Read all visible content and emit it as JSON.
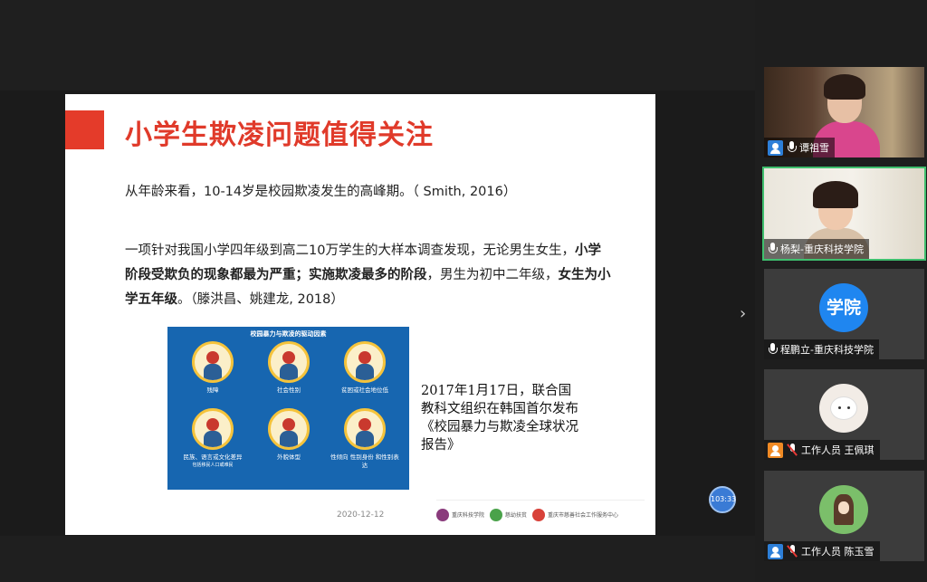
{
  "slide": {
    "title": "小学生欺凌问题值得关注",
    "paragraph1": "从年龄来看，10-14岁是校园欺凌发生的高峰期。（ Smith, 2016）",
    "paragraph2": {
      "t1": "一项针对我国小学四年级到高二10万学生的大样本调查发现，无论男生女生，",
      "b1": "小学阶段受欺负的现象都最为严重；实施欺凌最多的阶段",
      "t2": "，男生为初中二年级，",
      "b2": "女生为小学五年级",
      "t3": "。（滕洪昌、姚建龙, 2018）"
    },
    "infographic": {
      "title": "校园暴力与欺凌的驱动因素",
      "items": [
        "残障",
        "社会性别",
        "贫困或社会地位低",
        "民族、语言或文化差异",
        "外貌体型",
        "性倾向 性别身份 和性别表达"
      ],
      "footnote": "包括移民人口或难民"
    },
    "caption": "2017年1月17日，联合国教科文组织在韩国首尔发布《校园暴力与欺凌全球状况报告》",
    "date": "2020-12-12",
    "logos": [
      "重庆科技学院",
      "慈幼扶贫",
      "重庆市慈善社会工作服务中心"
    ]
  },
  "controls": {
    "next_arrow": "›",
    "timer": "103:33"
  },
  "participants": [
    {
      "name": "谭祖雪",
      "mic": "on",
      "video": true
    },
    {
      "name": "杨梨-重庆科技学院",
      "mic": "on",
      "video": true
    },
    {
      "name": "程鹏立-重庆科技学院",
      "mic": "on",
      "avatar_text": "学院"
    },
    {
      "name": "工作人员 王佩琪",
      "mic": "muted"
    },
    {
      "name": "工作人员 陈玉雪",
      "mic": "muted"
    }
  ],
  "colors": {
    "title_red": "#e03a2a",
    "infographic_blue": "#1766b0",
    "active_speaker": "#3fbf6e",
    "avatar_blue": "#1f86f0"
  }
}
